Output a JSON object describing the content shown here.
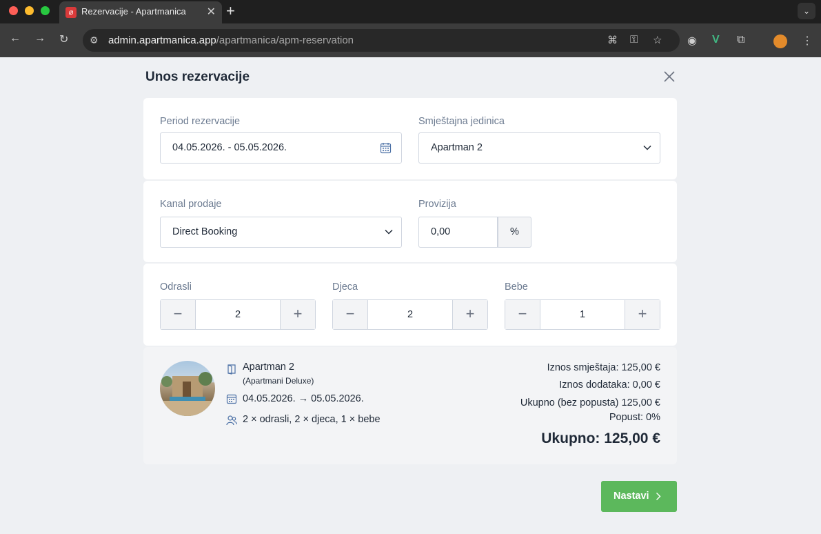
{
  "browser": {
    "tab_title": "Rezervacije - Apartmanica",
    "url_host": "admin.apartmanica.app",
    "url_path": "/apartmanica/apm-reservation"
  },
  "modal": {
    "title": "Unos rezervacije"
  },
  "period": {
    "label": "Period rezervacije",
    "value": "04.05.2026. - 05.05.2026."
  },
  "unit": {
    "label": "Smještajna jedinica",
    "value": "Apartman 2"
  },
  "channel": {
    "label": "Kanal prodaje",
    "value": "Direct Booking"
  },
  "commission": {
    "label": "Provizija",
    "value": "0,00",
    "unit": "%"
  },
  "guests": [
    {
      "label": "Odrasli",
      "value": "2"
    },
    {
      "label": "Djeca",
      "value": "2"
    },
    {
      "label": "Bebe",
      "value": "1"
    }
  ],
  "stepper_symbols": {
    "minus": "−",
    "plus": "+"
  },
  "summary": {
    "unit_name": "Apartman 2",
    "unit_type": "(Apartmani Deluxe)",
    "dates": "04.05.2026. → 05.05.2026.",
    "guests": "2 × odrasli, 2 × djeca, 1 × bebe",
    "accommodation": "Iznos smještaja: 125,00 €",
    "extras": "Iznos dodataka: 0,00 €",
    "subtotal": "Ukupno (bez popusta) 125,00 €",
    "discount": "Popust: 0%",
    "total": "Ukupno: 125,00 €"
  },
  "actions": {
    "next_label": "Nastavi"
  },
  "colors": {
    "accent_green": "#5cb85c",
    "label_gray": "#6b7a90"
  }
}
